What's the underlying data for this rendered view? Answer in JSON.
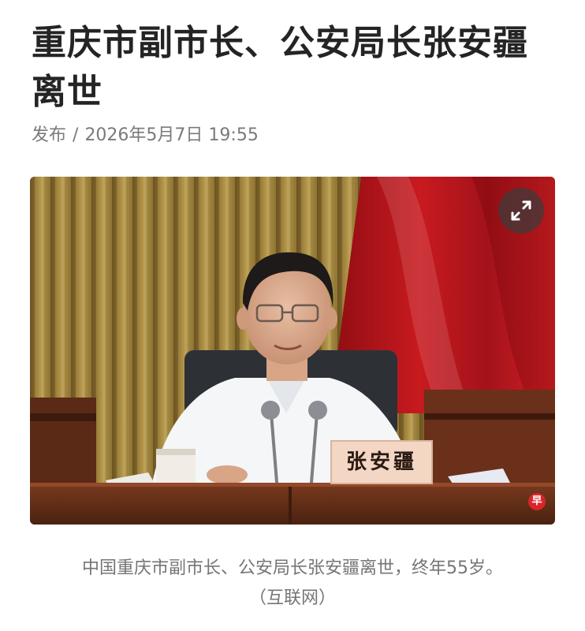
{
  "article": {
    "title": "重庆市副市长、公安局长张安疆离世",
    "publish_label": "发布",
    "separator": "/",
    "publish_datetime": "2026年5月7日 19:55"
  },
  "photo": {
    "nameplate_text": "张安疆",
    "expand_icon": "expand-arrows-icon",
    "watermark_logo_text": "早"
  },
  "caption": {
    "text": "中国重庆市副市长、公安局长张安疆离世，终年55岁。",
    "credit": "（互联网）"
  },
  "colors": {
    "title": "#242424",
    "meta": "#7a7a7a",
    "caption": "#757575",
    "curtain_red": "#b3141a",
    "curtain_gold": "#a8893c",
    "nameplate_bg": "#f3d7c4",
    "nameplate_text": "#2a1a12"
  }
}
